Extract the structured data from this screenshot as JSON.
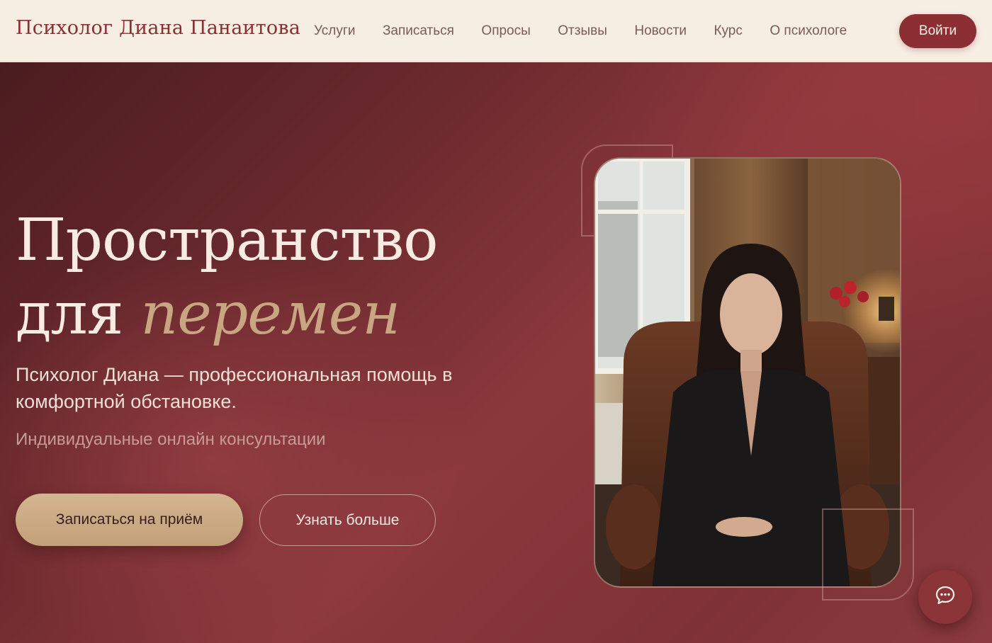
{
  "header": {
    "logo": "Психолог Диана Панаитова",
    "nav": [
      "Услуги",
      "Записаться",
      "Опросы",
      "Отзывы",
      "Новости",
      "Курс",
      "О психологе"
    ],
    "login_label": "Войти"
  },
  "hero": {
    "title_line1": "Пространство",
    "title_line2_plain": "для",
    "title_line2_accent": "перемен",
    "subtitle": "Психолог Диана — профессиональная помощь в комфортной обстановке.",
    "tagline": "Индивидуальные онлайн консультации",
    "primary_button": "Записаться на приём",
    "secondary_button": "Узнать больше"
  },
  "colors": {
    "brand": "#8b2f35",
    "header_bg": "#f6ede3",
    "accent_gold": "#c8a682"
  },
  "icons": {
    "chat": "chat-bubble-icon"
  }
}
